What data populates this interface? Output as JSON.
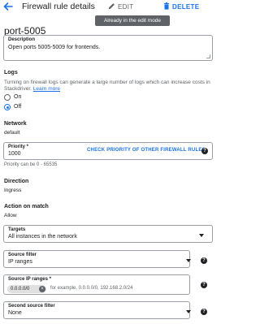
{
  "header": {
    "title": "Firewall rule details",
    "edit_label": "EDIT",
    "delete_label": "DELETE",
    "tooltip": "Already in the edit mode"
  },
  "rule_name": "port-5005",
  "description": {
    "label": "Description",
    "value": "Open ports 5005-5009 for frontends."
  },
  "logs": {
    "heading": "Logs",
    "text_line1": "Turning on firewall logs can generate a large number of logs which can increase costs in",
    "text_line2": "Stackdriver.",
    "learn_more": "Learn more",
    "options": [
      "On",
      "Off"
    ],
    "selected": "Off"
  },
  "network": {
    "heading": "Network",
    "value": "default"
  },
  "priority": {
    "label": "Priority *",
    "value": "1000",
    "check_link": "CHECK PRIORITY OF OTHER FIREWALL RULES",
    "hint": "Priority can be 0 - 65535"
  },
  "direction": {
    "heading": "Direction",
    "value": "Ingress"
  },
  "action": {
    "heading": "Action on match",
    "value": "Allow"
  },
  "targets": {
    "label": "Targets",
    "value": "All instances in the network"
  },
  "source_filter": {
    "label": "Source filter",
    "value": "IP ranges"
  },
  "source_ip": {
    "label": "Source IP ranges *",
    "chip": "0.0.0.0/0",
    "placeholder": "for example, 0.0.0.0/0, 192.168.2.0/24"
  },
  "second_source_filter": {
    "label": "Second source filter",
    "value": "None"
  },
  "colors": {
    "accent": "#1a73e8",
    "tooltip_bg": "#5f6368",
    "border": "#9aa0a6"
  }
}
